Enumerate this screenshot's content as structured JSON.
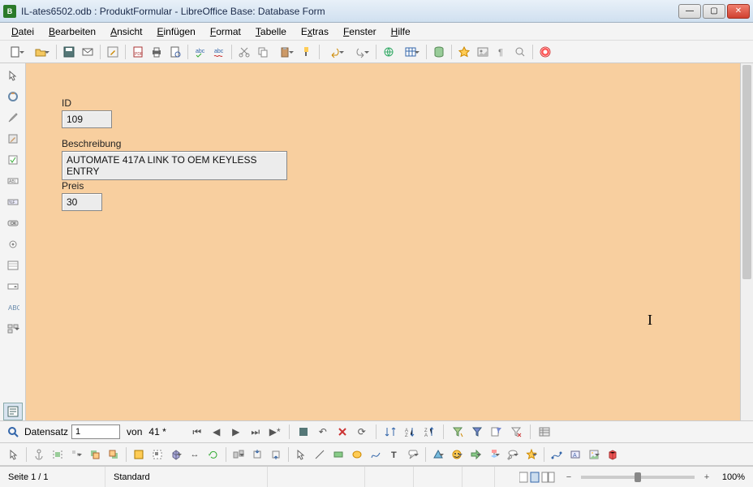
{
  "window": {
    "title": "IL-ates6502.odb : ProduktFormular - LibreOffice Base: Database Form"
  },
  "menu": {
    "items": [
      {
        "label": "Datei",
        "u": 0
      },
      {
        "label": "Bearbeiten",
        "u": 0
      },
      {
        "label": "Ansicht",
        "u": 0
      },
      {
        "label": "Einfügen",
        "u": 0
      },
      {
        "label": "Format",
        "u": 0
      },
      {
        "label": "Tabelle",
        "u": 0
      },
      {
        "label": "Extras",
        "u": 1
      },
      {
        "label": "Fenster",
        "u": 0
      },
      {
        "label": "Hilfe",
        "u": 0
      }
    ]
  },
  "form": {
    "id_label": "ID",
    "id_value": "109",
    "desc_label": "Beschreibung",
    "desc_value": "AUTOMATE 417A LINK TO OEM KEYLESS ENTRY",
    "price_label": "Preis",
    "price_value": "30"
  },
  "navigator": {
    "label": "Datensatz",
    "current": "1",
    "von": "von",
    "total": "41 *"
  },
  "status": {
    "page": "Seite 1 / 1",
    "style": "Standard",
    "zoom": "100%"
  }
}
